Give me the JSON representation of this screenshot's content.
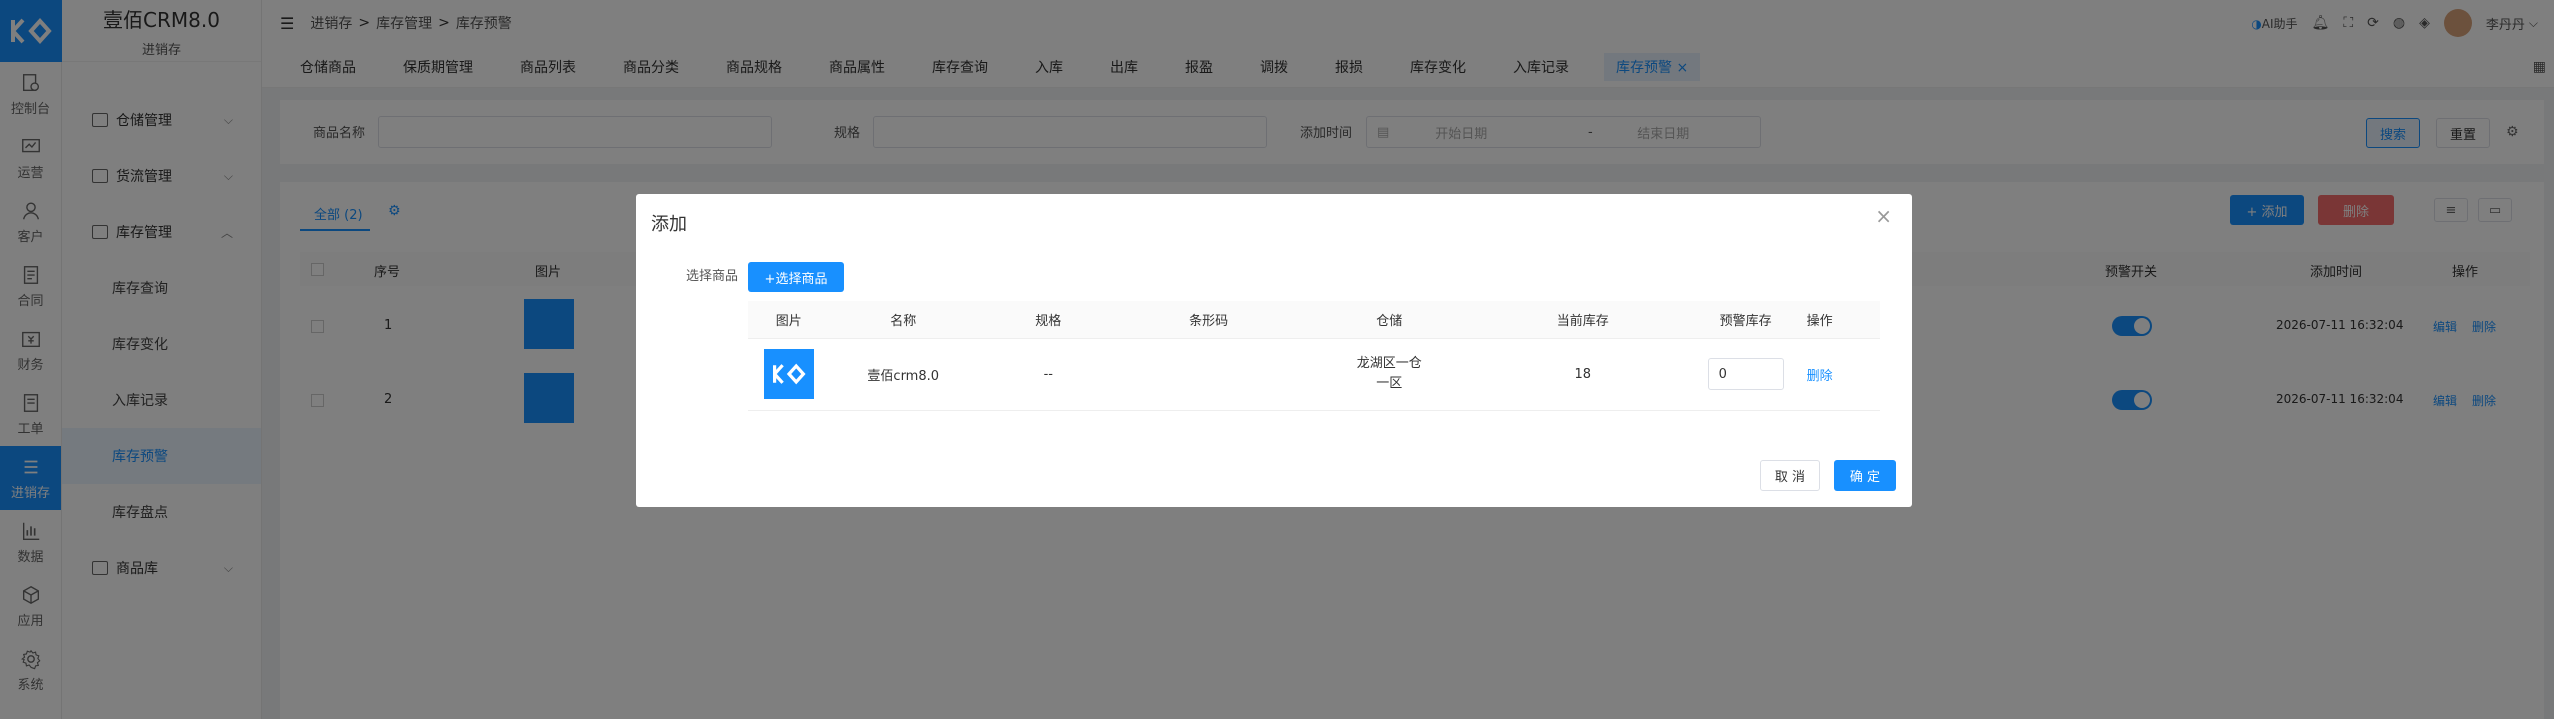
{
  "rail": {
    "items": [
      {
        "label": "控制台",
        "icon": "dashboard-icon"
      },
      {
        "label": "运营",
        "icon": "monitor-icon"
      },
      {
        "label": "客户",
        "icon": "user-icon"
      },
      {
        "label": "合同",
        "icon": "contract-icon"
      },
      {
        "label": "财务",
        "icon": "finance-icon"
      },
      {
        "label": "工单",
        "icon": "ticket-icon"
      },
      {
        "label": "进销存",
        "icon": "list-icon"
      },
      {
        "label": "数据",
        "icon": "chart-icon"
      },
      {
        "label": "应用",
        "icon": "cube-icon"
      },
      {
        "label": "系统",
        "icon": "gear-icon"
      }
    ]
  },
  "sidebar": {
    "brand": "壹佰CRM8.0",
    "module": "进销存",
    "menus": [
      "仓储管理",
      "货流管理",
      "库存管理"
    ],
    "submenus": [
      "库存查询",
      "库存变化",
      "入库记录",
      "库存预警",
      "库存盘点"
    ],
    "last_menu": "商品库"
  },
  "topbar": {
    "menu_icon": "hamburger-icon",
    "breadcrumb": [
      "进销存",
      "库存管理",
      "库存预警"
    ],
    "sep": ">",
    "ai_label": "AI助手",
    "user": "李丹丹"
  },
  "tabs": [
    "仓储商品",
    "保质期管理",
    "商品列表",
    "商品分类",
    "商品规格",
    "商品属性",
    "库存查询",
    "入库",
    "出库",
    "报盈",
    "调拨",
    "报损",
    "库存变化",
    "入库记录",
    "库存预警"
  ],
  "filter": {
    "name_label": "商品名称",
    "spec_label": "规格",
    "time_label": "添加时间",
    "start_placeholder": "开始日期",
    "range_sep": "-",
    "end_placeholder": "结束日期",
    "search_btn": "搜索",
    "reset_btn": "重置"
  },
  "list": {
    "tab_all": "全部 (2)",
    "add_btn": "+ 添加",
    "delete_btn": "删除",
    "headers": {
      "seq": "序号",
      "img": "图片",
      "warn_switch": "预警开关",
      "add_time": "添加时间",
      "ops": "操作"
    },
    "rows": [
      {
        "seq": "1",
        "time": "2026-07-11 16:32:04",
        "edit": "编辑",
        "del": "删除"
      },
      {
        "seq": "2",
        "time": "2026-07-11 16:32:04",
        "edit": "编辑",
        "del": "删除"
      }
    ]
  },
  "modal": {
    "title": "添加",
    "select_label": "选择商品",
    "select_btn": "+选择商品",
    "headers": [
      "图片",
      "名称",
      "规格",
      "条形码",
      "仓储",
      "当前库存",
      "预警库存",
      "操作"
    ],
    "row": {
      "name": "壹佰crm8.0",
      "spec": "--",
      "barcode": "",
      "warehouse_line1": "龙湖区一仓",
      "warehouse_line2": "一区",
      "stock": "18",
      "warn_stock": "0",
      "op": "删除"
    },
    "cancel_btn": "取 消",
    "ok_btn": "确 定"
  },
  "colors": {
    "primary": "#1890ff",
    "danger": "#f56c6c"
  }
}
